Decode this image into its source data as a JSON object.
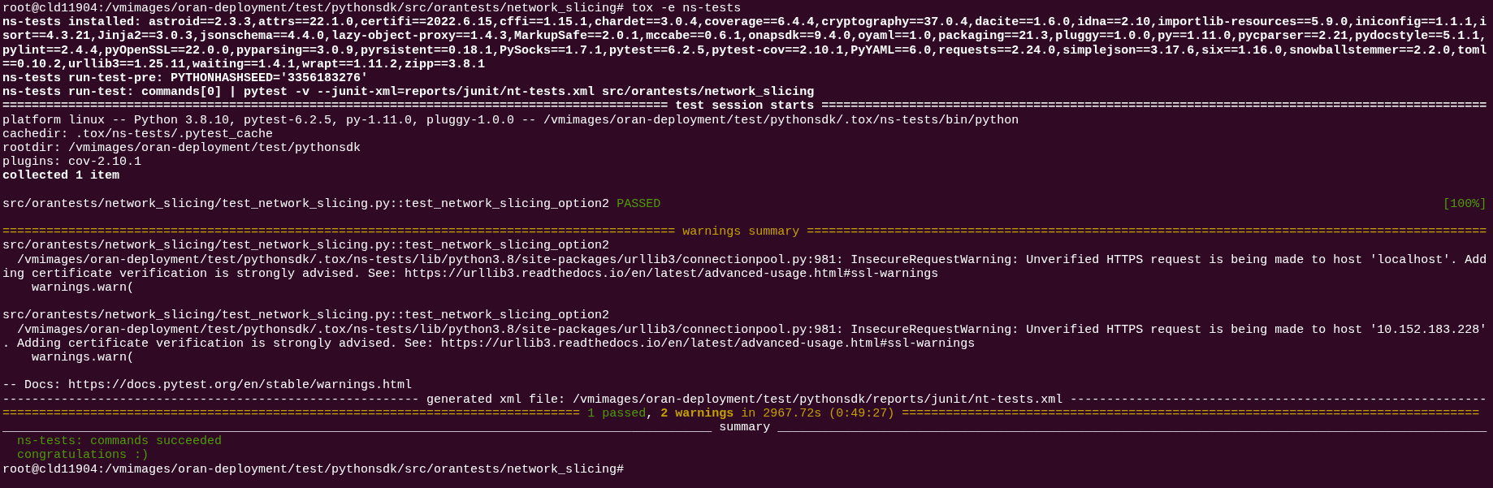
{
  "terminal": {
    "lines": [
      {
        "kind": "text",
        "spans": [
          {
            "kind": "plain",
            "text": "root@cld11904:/vmimages/oran-deployment/test/pythonsdk/src/orantests/network_slicing# tox -e ns-tests"
          }
        ]
      },
      {
        "kind": "text",
        "spans": [
          {
            "kind": "bold",
            "text": "ns-tests installed: astroid==2.3.3,attrs==22.1.0,certifi==2022.6.15,cffi==1.15.1,chardet==3.0.4,coverage==6.4.4,cryptography==37.0.4,dacite==1.6.0,idna==2.10,importlib-resources==5.9.0,iniconfig==1.1.1,isort==4.3.21,Jinja2==3.0.3,jsonschema==4.4.0,lazy-object-proxy==1.4.3,MarkupSafe==2.0.1,mccabe==0.6.1,onapsdk==9.4.0,oyaml==1.0,packaging==21.3,pluggy==1.0.0,py==1.11.0,pycparser==2.21,pydocstyle==5.1.1,pylint==2.4.4,pyOpenSSL==22.0.0,pyparsing==3.0.9,pyrsistent==0.18.1,PySocks==1.7.1,pytest==6.2.5,pytest-cov==2.10.1,PyYAML==6.0,requests==2.24.0,simplejson==3.17.6,six==1.16.0,snowballstemmer==2.2.0,toml==0.10.2,urllib3==1.25.11,waiting==1.4.1,wrapt==1.11.2,zipp==3.8.1"
          }
        ]
      },
      {
        "kind": "text",
        "spans": [
          {
            "kind": "bold",
            "text": "ns-tests run-test-pre: PYTHONHASHSEED='3356183276'"
          }
        ]
      },
      {
        "kind": "text",
        "spans": [
          {
            "kind": "bold",
            "text": "ns-tests run-test: commands[0] | pytest -v --junit-xml=reports/junit/nt-tests.xml src/orantests/network_slicing"
          }
        ]
      },
      {
        "kind": "text",
        "spans": [
          {
            "kind": "bold",
            "text": "=========================================================================================== test session starts ==========================================================================================="
          }
        ]
      },
      {
        "kind": "text",
        "spans": [
          {
            "kind": "plain",
            "text": "platform linux -- Python 3.8.10, pytest-6.2.5, py-1.11.0, pluggy-1.0.0 -- /vmimages/oran-deployment/test/pythonsdk/.tox/ns-tests/bin/python"
          }
        ]
      },
      {
        "kind": "text",
        "spans": [
          {
            "kind": "plain",
            "text": "cachedir: .tox/ns-tests/.pytest_cache"
          }
        ]
      },
      {
        "kind": "text",
        "spans": [
          {
            "kind": "plain",
            "text": "rootdir: /vmimages/oran-deployment/test/pythonsdk"
          }
        ]
      },
      {
        "kind": "text",
        "spans": [
          {
            "kind": "plain",
            "text": "plugins: cov-2.10.1"
          }
        ]
      },
      {
        "kind": "text",
        "spans": [
          {
            "kind": "bold",
            "text": "collected 1 item"
          }
        ]
      },
      {
        "kind": "blank"
      },
      {
        "kind": "text",
        "spans": [
          {
            "kind": "plain",
            "text": "src/orantests/network_slicing/test_network_slicing.py::test_network_slicing_option2 "
          },
          {
            "kind": "pass",
            "text": "PASSED"
          },
          {
            "kind": "pass",
            "text": "[100%]",
            "end": true
          }
        ]
      },
      {
        "kind": "blank"
      },
      {
        "kind": "text",
        "spans": [
          {
            "kind": "warn",
            "text": "============================================================================================ warnings summary ============================================================================================="
          }
        ]
      },
      {
        "kind": "text",
        "spans": [
          {
            "kind": "plain",
            "text": "src/orantests/network_slicing/test_network_slicing.py::test_network_slicing_option2"
          }
        ]
      },
      {
        "kind": "text",
        "spans": [
          {
            "kind": "plain",
            "text": "  /vmimages/oran-deployment/test/pythonsdk/.tox/ns-tests/lib/python3.8/site-packages/urllib3/connectionpool.py:981: InsecureRequestWarning: Unverified HTTPS request is being made to host 'localhost'. Adding certificate verification is strongly advised. See: https://urllib3.readthedocs.io/en/latest/advanced-usage.html#ssl-warnings"
          }
        ]
      },
      {
        "kind": "text",
        "spans": [
          {
            "kind": "plain",
            "text": "    warnings.warn("
          }
        ]
      },
      {
        "kind": "blank"
      },
      {
        "kind": "text",
        "spans": [
          {
            "kind": "plain",
            "text": "src/orantests/network_slicing/test_network_slicing.py::test_network_slicing_option2"
          }
        ]
      },
      {
        "kind": "text",
        "spans": [
          {
            "kind": "plain",
            "text": "  /vmimages/oran-deployment/test/pythonsdk/.tox/ns-tests/lib/python3.8/site-packages/urllib3/connectionpool.py:981: InsecureRequestWarning: Unverified HTTPS request is being made to host '10.152.183.228'. Adding certificate verification is strongly advised. See: https://urllib3.readthedocs.io/en/latest/advanced-usage.html#ssl-warnings"
          }
        ]
      },
      {
        "kind": "text",
        "spans": [
          {
            "kind": "plain",
            "text": "    warnings.warn("
          }
        ]
      },
      {
        "kind": "blank"
      },
      {
        "kind": "text",
        "spans": [
          {
            "kind": "plain",
            "text": "-- Docs: https://docs.pytest.org/en/stable/warnings.html"
          }
        ]
      },
      {
        "kind": "text",
        "spans": [
          {
            "kind": "plain",
            "text": "--------------------------------------------------------- generated xml file: /vmimages/oran-deployment/test/pythonsdk/reports/junit/nt-tests.xml ---------------------------------------------------------"
          }
        ]
      },
      {
        "kind": "text",
        "spans": [
          {
            "kind": "warn",
            "text": "=============================================================================== "
          },
          {
            "kind": "pass",
            "text": "1 passed"
          },
          {
            "kind": "plain",
            "text": ", "
          },
          {
            "kind": "warn-bold",
            "text": "2 warnings"
          },
          {
            "kind": "warn",
            "text": " in 2967.72s (0:49:27) ==============================================================================="
          }
        ]
      },
      {
        "kind": "text",
        "spans": [
          {
            "kind": "plain",
            "text": "_________________________________________________________________________________________________ summary _________________________________________________________________________________________________"
          }
        ]
      },
      {
        "kind": "text",
        "spans": [
          {
            "kind": "pass",
            "text": "  ns-tests: commands succeeded"
          }
        ]
      },
      {
        "kind": "text",
        "spans": [
          {
            "kind": "pass",
            "text": "  congratulations :)"
          }
        ]
      },
      {
        "kind": "text",
        "spans": [
          {
            "kind": "plain",
            "text": "root@cld11904:/vmimages/oran-deployment/test/pythonsdk/src/orantests/network_slicing#"
          }
        ]
      }
    ]
  }
}
